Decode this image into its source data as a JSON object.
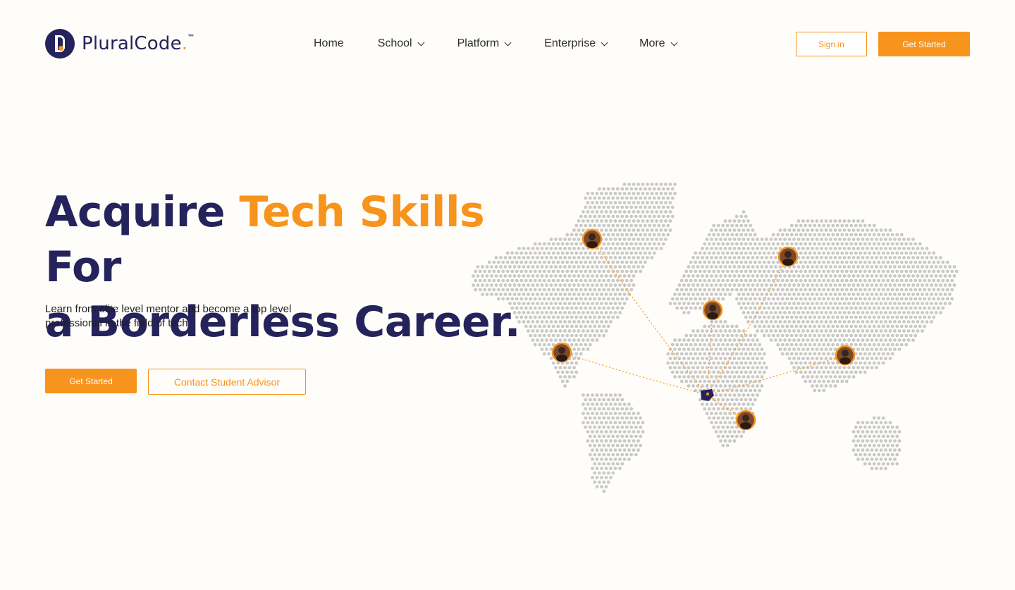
{
  "brand": {
    "name_main": "PluralCode",
    "name_dot": ".",
    "trademark": "™"
  },
  "nav": {
    "items": [
      {
        "label": "Home",
        "has_dropdown": false
      },
      {
        "label": "School",
        "has_dropdown": true
      },
      {
        "label": "Platform",
        "has_dropdown": true
      },
      {
        "label": "Enterprise",
        "has_dropdown": true
      },
      {
        "label": "More",
        "has_dropdown": true
      }
    ]
  },
  "header_actions": {
    "sign_in": "Sign in",
    "get_started": "Get Started"
  },
  "hero": {
    "title_part1": "Acquire ",
    "title_accent": "Tech Skills",
    "title_part2": " For",
    "title_line2": "a Borderless Career.",
    "subtitle": "Learn from elite level mentor and become a top level professional in the field of tech",
    "cta_primary": "Get Started",
    "cta_secondary": "Contact Student Advisor"
  },
  "map": {
    "markers": [
      {
        "name": "avatar-europe-north"
      },
      {
        "name": "avatar-asia-north"
      },
      {
        "name": "avatar-middle-east"
      },
      {
        "name": "avatar-north-america"
      },
      {
        "name": "avatar-south-asia"
      },
      {
        "name": "avatar-southern-africa"
      },
      {
        "name": "nigeria-hub"
      }
    ]
  },
  "colors": {
    "brand_navy": "#24235c",
    "brand_orange": "#f7941d",
    "background": "#fffdf9",
    "map_dot": "#c9c9c9"
  }
}
